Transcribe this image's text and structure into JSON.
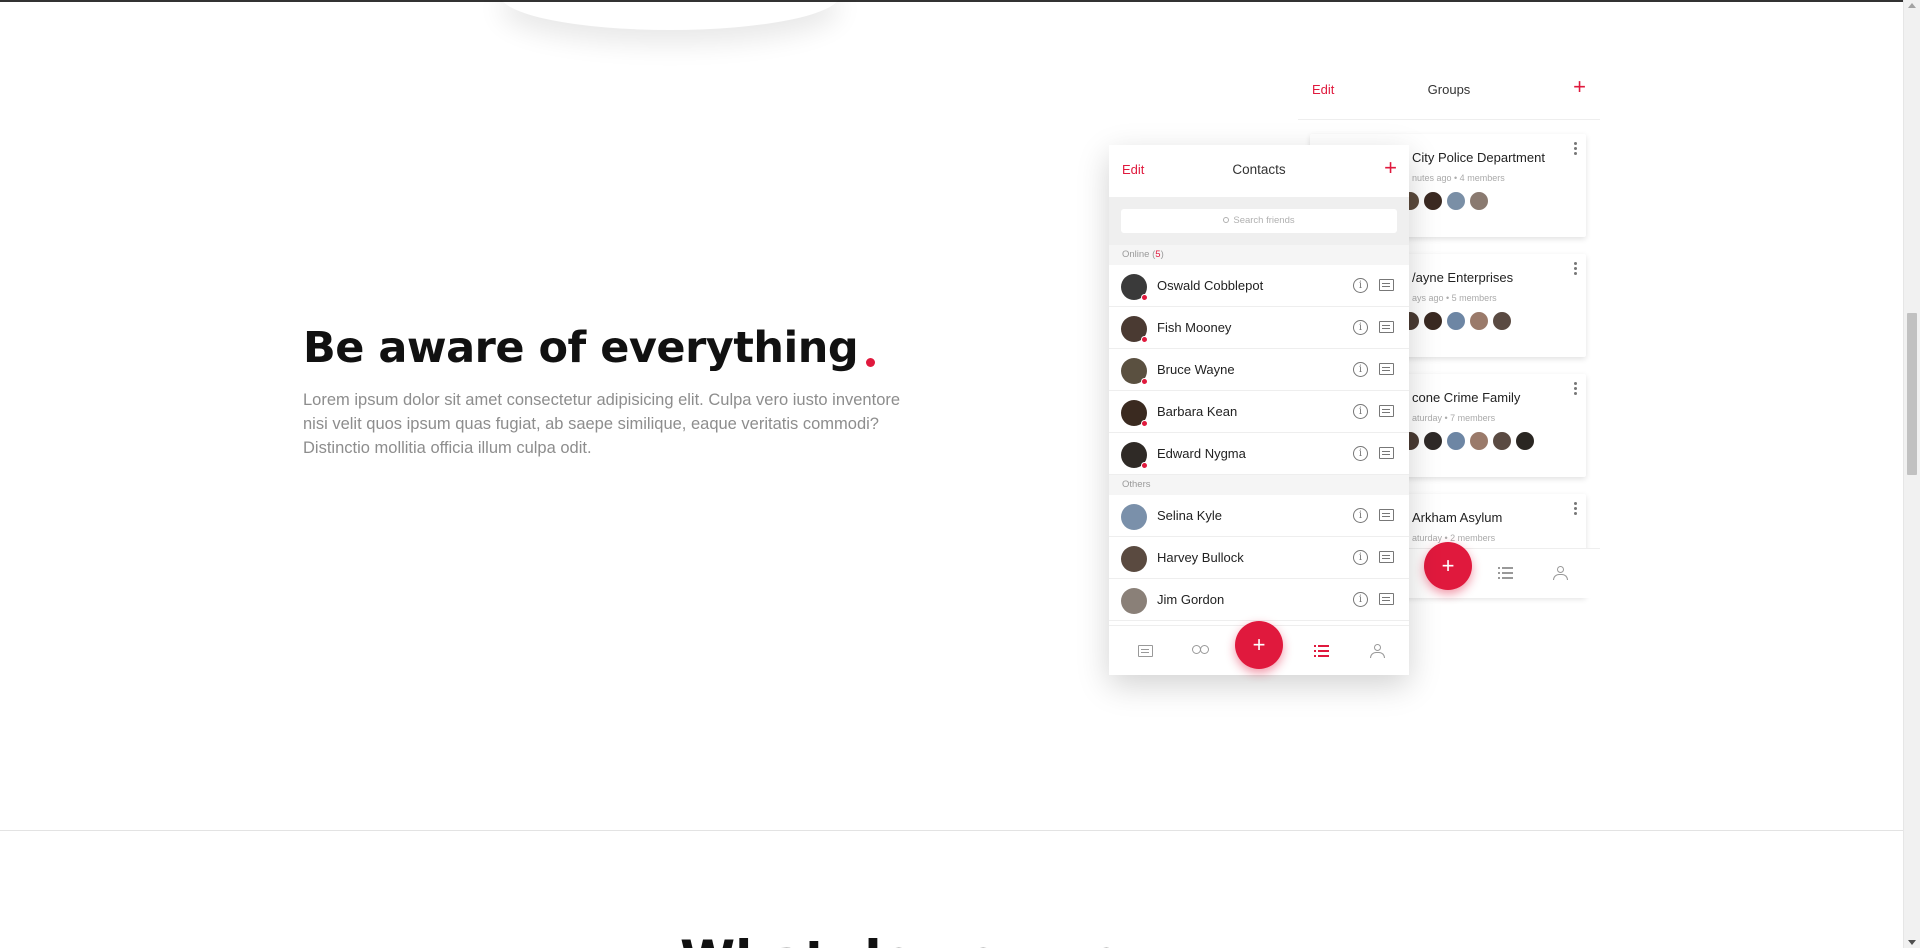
{
  "hero": {
    "title": "Be aware of everything",
    "body": "Lorem ipsum dolor sit amet consectetur adipisicing elit. Culpa vero iusto inventore nisi velit quos ipsum quas fugiat, ab saepe similique, eaque veritatis commodi? Distinctio mollitia officia illum culpa odit."
  },
  "next_section": {
    "title_partial": "What do you ge"
  },
  "groups_panel": {
    "edit": "Edit",
    "title": "Groups",
    "plus": "+",
    "fab": "+",
    "cards": [
      {
        "name": "City Police Department",
        "meta": "nutes ago  •  4 members",
        "avatars": [
          "#5b4a3c",
          "#3b2a22",
          "#7a8fa6",
          "#8a7a70"
        ]
      },
      {
        "name": "/ayne Enterprises",
        "meta": "ays ago  •  5 members",
        "avatars": [
          "#4a3b33",
          "#3a2a22",
          "#6d86a4",
          "#9a7a6a",
          "#5a4a42"
        ]
      },
      {
        "name": "cone Crime Family",
        "meta": "aturday  •  7 members",
        "avatars": [
          "#4a3b33",
          "#2f2a28",
          "#6d86a4",
          "#9a7a6a",
          "#5a4a42",
          "#2a2622"
        ]
      },
      {
        "name": "Arkham Asylum",
        "meta": "aturday  •  2 members",
        "avatars": []
      }
    ]
  },
  "contacts_panel": {
    "edit": "Edit",
    "title": "Contacts",
    "plus": "+",
    "search_placeholder": "Search friends",
    "online_label": "Online (",
    "online_count": "5",
    "online_close": ")",
    "others_label": "Others",
    "online": [
      {
        "name": "Oswald Cobblepot",
        "color": "#3a3a3a"
      },
      {
        "name": "Fish Mooney",
        "color": "#4a3a32"
      },
      {
        "name": "Bruce Wayne",
        "color": "#5a5040"
      },
      {
        "name": "Barbara Kean",
        "color": "#3a2a20"
      },
      {
        "name": "Edward Nygma",
        "color": "#2f2a26"
      }
    ],
    "others": [
      {
        "name": "Selina Kyle",
        "color": "#7a90aa"
      },
      {
        "name": "Harvey Bullock",
        "color": "#5a4a40"
      },
      {
        "name": "Jim Gordon",
        "color": "#8a8078"
      }
    ],
    "fab": "+",
    "info_glyph": "i"
  },
  "colors": {
    "accent": "#e0193d",
    "text": "#111111",
    "muted": "#8d8d8d"
  }
}
